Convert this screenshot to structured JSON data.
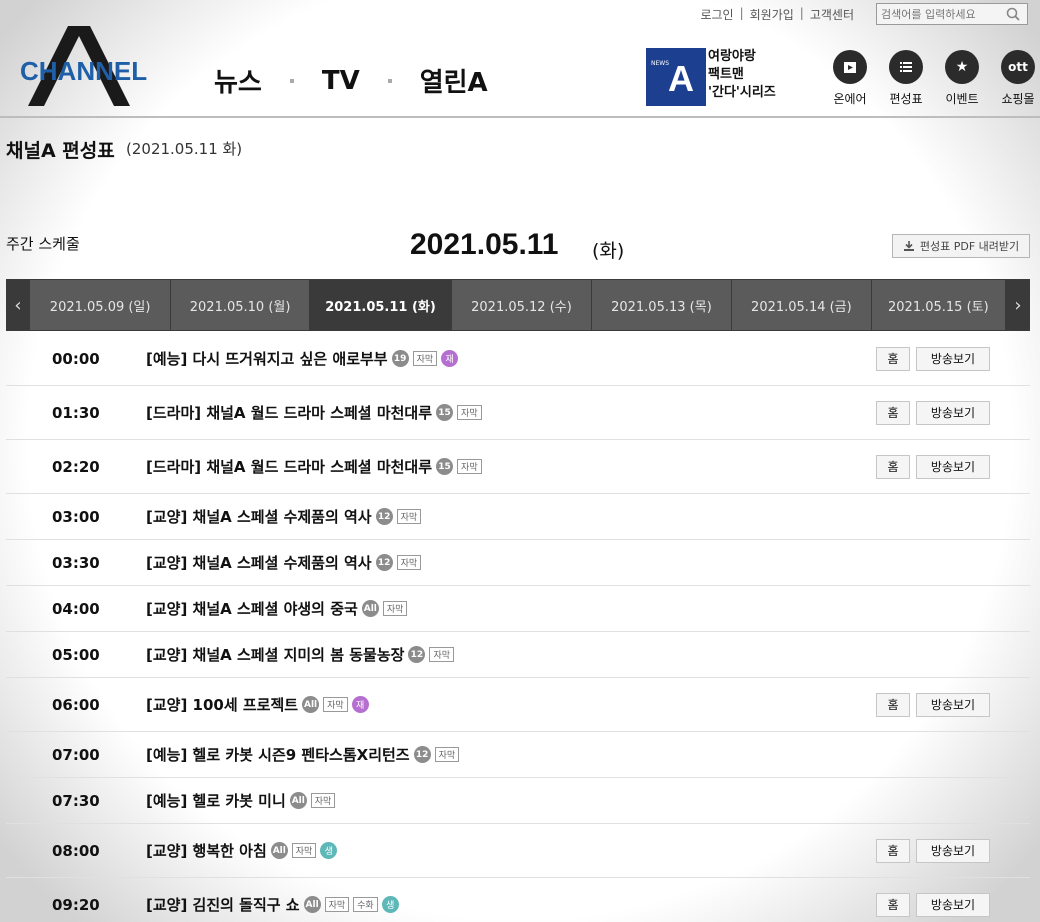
{
  "util": {
    "login": "로그인",
    "join": "회원가입",
    "support": "고객센터",
    "search_placeholder": "검색어를 입력하세요"
  },
  "logo": {
    "text": "CHANNEL",
    "letter": "A"
  },
  "gnb": [
    "뉴스",
    "TV",
    "열린A"
  ],
  "promo": {
    "badge": "NEWS",
    "letter": "A",
    "lines": [
      "여랑야랑",
      "팩트맨",
      "'간다'시리즈"
    ]
  },
  "quick": [
    {
      "label": "온에어",
      "icon": "play-icon"
    },
    {
      "label": "편성표",
      "icon": "list-icon"
    },
    {
      "label": "이벤트",
      "icon": "star-icon"
    },
    {
      "label": "쇼핑몰",
      "icon": "ott-icon"
    }
  ],
  "page": {
    "title": "채널A 편성표",
    "date": "(2021.05.11 화)"
  },
  "weekly": {
    "label": "주간 스케줄",
    "date": "2021.05.11",
    "day": "(화)",
    "pdf": "편성표 PDF 내려받기"
  },
  "tabs": [
    {
      "label": "2021.05.09 (일)",
      "active": false
    },
    {
      "label": "2021.05.10 (월)",
      "active": false
    },
    {
      "label": "2021.05.11 (화)",
      "active": true
    },
    {
      "label": "2021.05.12 (수)",
      "active": false
    },
    {
      "label": "2021.05.13 (목)",
      "active": false
    },
    {
      "label": "2021.05.14 (금)",
      "active": false
    },
    {
      "label": "2021.05.15 (토)",
      "active": false
    }
  ],
  "buttons": {
    "home": "홈",
    "watch": "방송보기"
  },
  "schedule": [
    {
      "time": "00:00",
      "title": "[예능] 다시 뜨거워지고 싶은 애로부부",
      "badges": [
        "19",
        "자막",
        "재"
      ],
      "buttons": true
    },
    {
      "time": "01:30",
      "title": "[드라마] 채널A 월드 드라마 스페셜 마천대루",
      "badges": [
        "15",
        "자막"
      ],
      "buttons": true
    },
    {
      "time": "02:20",
      "title": "[드라마] 채널A 월드 드라마 스페셜 마천대루",
      "badges": [
        "15",
        "자막"
      ],
      "buttons": true
    },
    {
      "time": "03:00",
      "title": "[교양] 채널A 스페셜 수제품의 역사",
      "badges": [
        "12",
        "자막"
      ],
      "buttons": false
    },
    {
      "time": "03:30",
      "title": "[교양] 채널A 스페셜 수제품의 역사",
      "badges": [
        "12",
        "자막"
      ],
      "buttons": false
    },
    {
      "time": "04:00",
      "title": "[교양] 채널A 스페셜 야생의 중국",
      "badges": [
        "All",
        "자막"
      ],
      "buttons": false
    },
    {
      "time": "05:00",
      "title": "[교양] 채널A 스페셜 지미의 봄 동물농장",
      "badges": [
        "12",
        "자막"
      ],
      "buttons": false
    },
    {
      "time": "06:00",
      "title": "[교양] 100세 프로젝트",
      "badges": [
        "All",
        "자막",
        "재"
      ],
      "buttons": true
    },
    {
      "time": "07:00",
      "title": "[예능] 헬로 카봇 시즌9 펜타스톰X리턴즈",
      "badges": [
        "12",
        "자막"
      ],
      "buttons": false
    },
    {
      "time": "07:30",
      "title": "[예능] 헬로 카봇 미니",
      "badges": [
        "All",
        "자막"
      ],
      "buttons": false
    },
    {
      "time": "08:00",
      "title": "[교양] 행복한 아침",
      "badges": [
        "All",
        "자막",
        "생"
      ],
      "buttons": true
    },
    {
      "time": "09:20",
      "title": "[교양] 김진의 돌직구 쇼",
      "badges": [
        "All",
        "자막",
        "수화",
        "생"
      ],
      "buttons": true
    }
  ]
}
